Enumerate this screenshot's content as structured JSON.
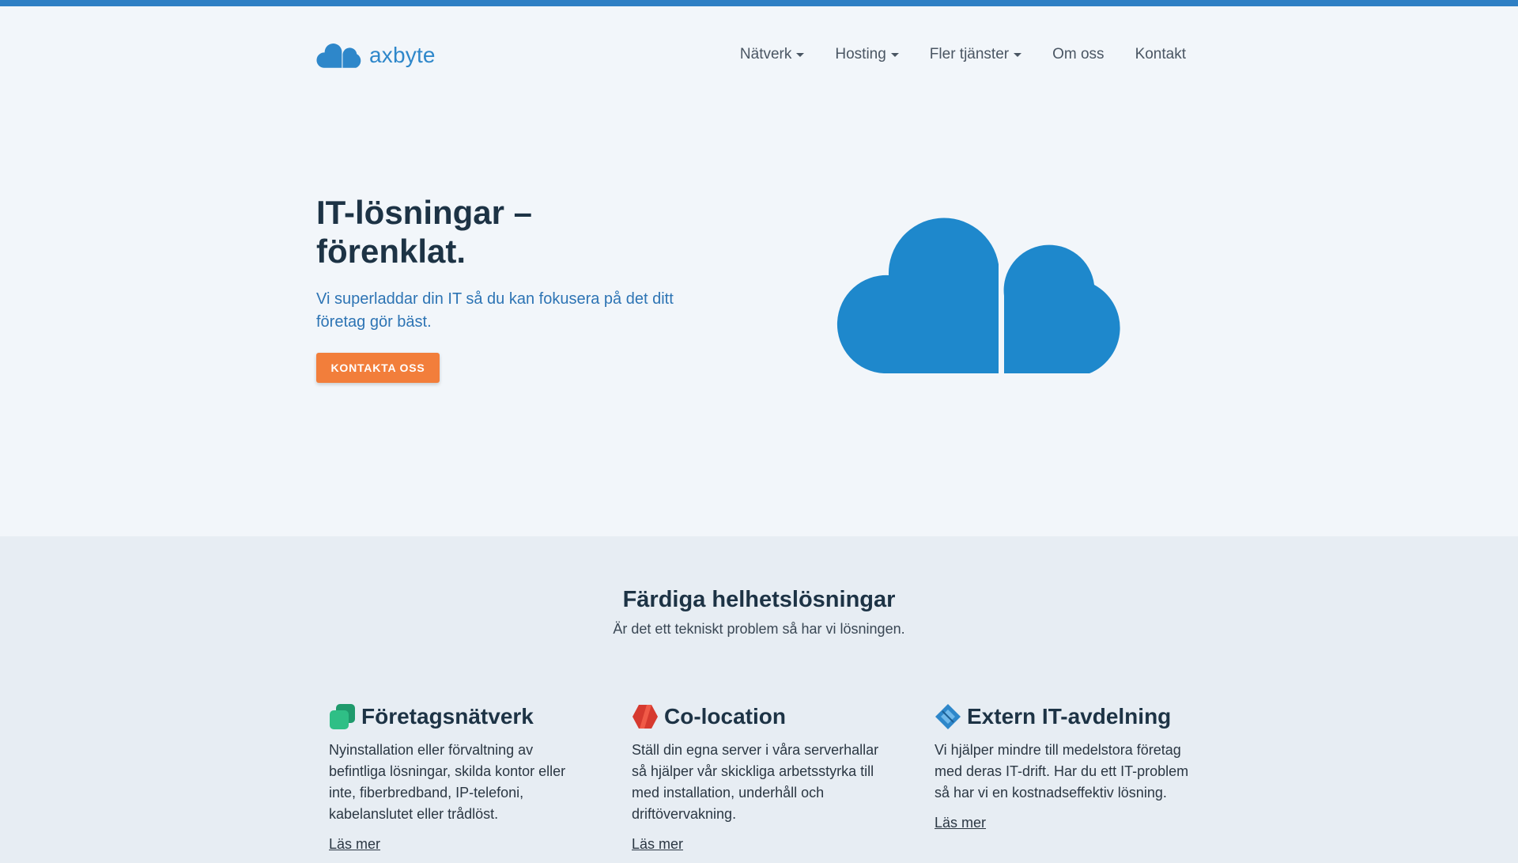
{
  "brand": {
    "name": "axbyte",
    "color": "#2e87ca",
    "accent_bar_color": "#2e7fc4"
  },
  "nav": {
    "items": [
      {
        "label": "Nätverk",
        "has_dropdown": true
      },
      {
        "label": "Hosting",
        "has_dropdown": true
      },
      {
        "label": "Fler tjänster",
        "has_dropdown": true
      },
      {
        "label": "Om oss",
        "has_dropdown": false
      },
      {
        "label": "Kontakt",
        "has_dropdown": false
      }
    ]
  },
  "hero": {
    "title_line1": "IT-lösningar –",
    "title_line2": "förenklat.",
    "subtitle": "Vi superladdar din IT så du kan fokusera på det ditt företag gör bäst.",
    "cta_label": "KONTAKTA OSS",
    "cta_color": "#f27e3b",
    "illustration": "cloud-icon"
  },
  "solutions": {
    "title": "Färdiga helhetslösningar",
    "subtitle": "Är det ett tekniskt problem så har vi lösningen.",
    "cards": [
      {
        "icon": "stacked-squares-icon",
        "icon_color": "#26b07d",
        "title": "Företagsnätverk",
        "text": "Nyinstallation eller förvaltning av befintliga lösningar, skilda kontor eller inte, fiberbredband, IP-telefoni, kabelanslutet eller trådlöst.",
        "link": "Läs mer"
      },
      {
        "icon": "hexagon-icon",
        "icon_color": "#d63a2f",
        "title": "Co-location",
        "text": "Ställ din egna server i våra serverhallar så hjälper vår skickliga arbetsstyrka till med installation, underhåll och driftövervakning.",
        "link": "Läs mer"
      },
      {
        "icon": "diamond-icon",
        "icon_color": "#2e87ca",
        "title": "Extern IT-avdelning",
        "text": "Vi hjälper mindre till medelstora företag med deras IT-drift. Har du ett IT-problem så har vi en kostnadseffektiv lösning.",
        "link": "Läs mer"
      }
    ]
  }
}
